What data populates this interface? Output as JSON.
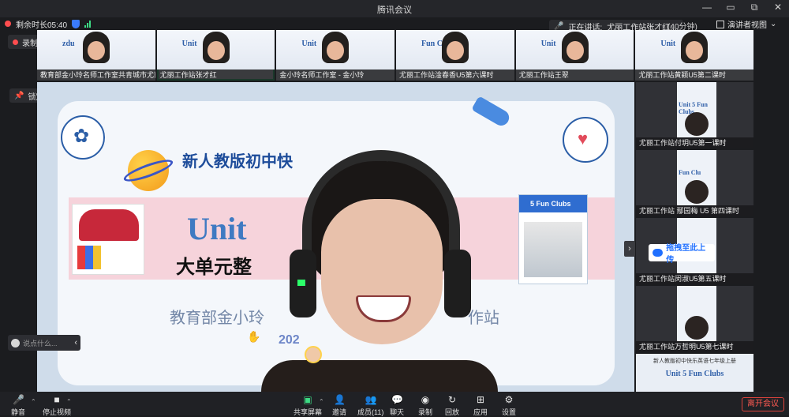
{
  "window": {
    "title": "腾讯会议",
    "controls": [
      "—",
      "▭",
      "⧉",
      "✕"
    ]
  },
  "status": {
    "remaining_time": "剩余时长05:40"
  },
  "speaking": {
    "label": "正在讲话:",
    "name": "尤丽工作站张才红;..."
  },
  "duration": "(40分钟)",
  "view_mode": "演讲者视图",
  "recording": "录制中",
  "lock_screen": "锁定画面",
  "thumbnails": [
    {
      "label": "教育部金小玲名师工作室共青城市尤丽",
      "slide": "zdu"
    },
    {
      "label": "尤丽工作站张才红",
      "slide": "Unit"
    },
    {
      "label": "金小玲名师工作室 - 金小玲",
      "slide": "Unit"
    },
    {
      "label": "尤丽工作站淦春香U5第六课时",
      "slide": "Fun Clubs"
    },
    {
      "label": "尤丽工作站王翠",
      "slide": "Unit"
    },
    {
      "label": "尤丽工作站黄颖U5第二课时",
      "slide": "Unit"
    }
  ],
  "side_tiles": [
    {
      "label": "尤丽工作站付玥U5第一课时",
      "slide": "Unit 5 Fun Clubs"
    },
    {
      "label": "尤丽工作站 鄢园梅 U5 第四课时",
      "slide": "Fun Clu"
    },
    {
      "label": "尤丽工作站闵淑U5第五课时",
      "slide": ""
    },
    {
      "label": "尤丽工作站万哲明U5第七课时",
      "slide": ""
    }
  ],
  "last_tile": {
    "mini": "新人教版初中快乐英语七年级上册",
    "big": "Unit 5 Fun Clubs"
  },
  "upload_label": "拖拽至此上传",
  "slide": {
    "headline": "新人教版初中快",
    "unit": "Unit",
    "subhead": "大单元整",
    "fun_clubs": "5 Fun Clubs",
    "footer": "教育部金小玲",
    "footer_tail": "作站",
    "year": "202"
  },
  "chat_placeholder": "说点什么...",
  "toolbar": {
    "mute": "静音",
    "stop_video": "停止视频",
    "share": "共享屏幕",
    "invite": "邀请",
    "members": "成员(11)",
    "chat": "聊天",
    "record": "录制",
    "replay": "回放",
    "apps": "应用",
    "settings": "设置",
    "leave": "离开会议"
  },
  "colors": {
    "accent_green": "#3ddc84",
    "leave_red": "#e0443d",
    "brand_blue": "#1f6fff"
  }
}
